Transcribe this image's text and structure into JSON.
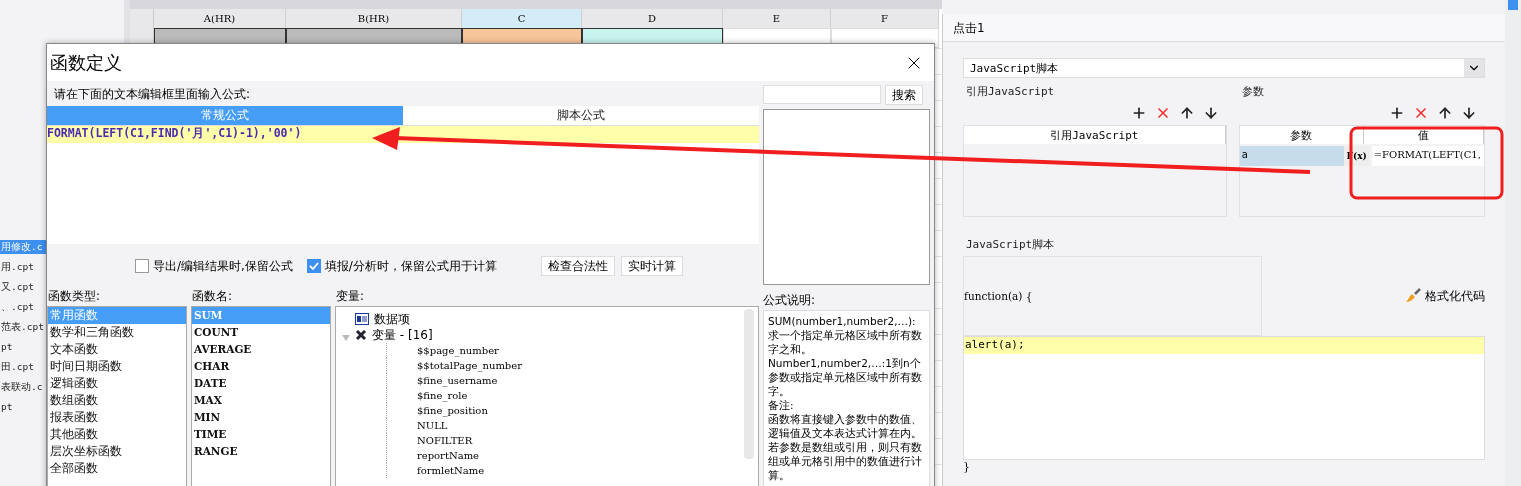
{
  "spreadsheet": {
    "columns": [
      {
        "label": "A(HR)",
        "selected": false
      },
      {
        "label": "B(HR)",
        "selected": false
      },
      {
        "label": "C",
        "selected": true
      },
      {
        "label": "D",
        "selected": false
      },
      {
        "label": "E",
        "selected": false
      },
      {
        "label": "F",
        "selected": false
      }
    ]
  },
  "file_list": {
    "items": [
      {
        "label": "用修改.c",
        "selected": true
      },
      {
        "label": "用.cpt",
        "selected": false
      },
      {
        "label": "又.cpt",
        "selected": false
      },
      {
        "label": "、.cpt",
        "selected": false
      },
      {
        "label": "范表.cpt",
        "selected": false
      },
      {
        "label": "pt",
        "selected": false
      },
      {
        "label": "田.cpt",
        "selected": false
      },
      {
        "label": "表联动.c",
        "selected": false
      },
      {
        "label": "pt",
        "selected": false
      }
    ]
  },
  "dialog": {
    "title": "函数定义",
    "prompt": "请在下面的文本编辑框里面输入公式:",
    "editor_tabs": [
      {
        "label": "常规公式",
        "selected": true
      },
      {
        "label": "脚本公式",
        "selected": false
      }
    ],
    "formula": "FORMAT(LEFT(C1,FIND('月',C1)-1),'00')",
    "search": {
      "button": "搜索"
    },
    "options": [
      {
        "label": "导出/编辑结果时,保留公式",
        "checked": false
      },
      {
        "label": "填报/分析时，保留公式用于计算",
        "checked": true
      }
    ],
    "buttons": [
      "检查合法性",
      "实时计算"
    ],
    "function_types": {
      "label": "函数类型:",
      "items": [
        {
          "label": "常用函数",
          "selected": true
        },
        {
          "label": "数学和三角函数",
          "selected": false
        },
        {
          "label": "文本函数",
          "selected": false
        },
        {
          "label": "时间日期函数",
          "selected": false
        },
        {
          "label": "逻辑函数",
          "selected": false
        },
        {
          "label": "数组函数",
          "selected": false
        },
        {
          "label": "报表函数",
          "selected": false
        },
        {
          "label": "其他函数",
          "selected": false
        },
        {
          "label": "层次坐标函数",
          "selected": false
        },
        {
          "label": "全部函数",
          "selected": false
        }
      ]
    },
    "function_names": {
      "label": "函数名:",
      "items": [
        {
          "label": "SUM",
          "selected": true
        },
        {
          "label": "COUNT",
          "selected": false
        },
        {
          "label": "AVERAGE",
          "selected": false
        },
        {
          "label": "CHAR",
          "selected": false
        },
        {
          "label": "DATE",
          "selected": false
        },
        {
          "label": "MAX",
          "selected": false
        },
        {
          "label": "MIN",
          "selected": false
        },
        {
          "label": "TIME",
          "selected": false
        },
        {
          "label": "RANGE",
          "selected": false
        }
      ]
    },
    "variables": {
      "label": "变量:",
      "items": [
        {
          "label": "数据项",
          "kind": "data"
        },
        {
          "label": "变量 - [16]",
          "kind": "group",
          "expanded": true,
          "children": [
            {
              "label": "$$page_number"
            },
            {
              "label": "$$totalPage_number"
            },
            {
              "label": "$fine_username"
            },
            {
              "label": "$fine_role"
            },
            {
              "label": "$fine_position"
            },
            {
              "label": "NULL"
            },
            {
              "label": "NOFILTER"
            },
            {
              "label": "reportName"
            },
            {
              "label": "formletName"
            }
          ]
        }
      ]
    },
    "description": {
      "label": "公式说明:",
      "paragraphs": [
        "SUM(number1,number2,…):求一个指定单元格区域中所有数字之和。",
        "Number1,number2,…:1到n个参数或指定单元格区域中所有数字。",
        "备注:",
        "函数将直接键入参数中的数值、逻辑值及文本表达式计算在内。若参数是数组或引用，则只有数组或单元格引用中的数值进行计算。"
      ]
    }
  },
  "event_panel": {
    "title": "点击1",
    "script_type": "JavaScript脚本",
    "references": {
      "label": "引用JavaScript",
      "column": "引用JavaScript"
    },
    "parameters": {
      "label": "参数",
      "columns": [
        "参数",
        "值"
      ],
      "rows": [
        {
          "name": "a",
          "formula_button": "F(x)",
          "value": "=FORMAT(LEFT(C1,",
          "selected": true
        }
      ]
    },
    "script": {
      "label": "JavaScript脚本",
      "header": "function(a) {",
      "code": "alert(a);",
      "footer": "}",
      "format_button": "格式化代码"
    }
  }
}
